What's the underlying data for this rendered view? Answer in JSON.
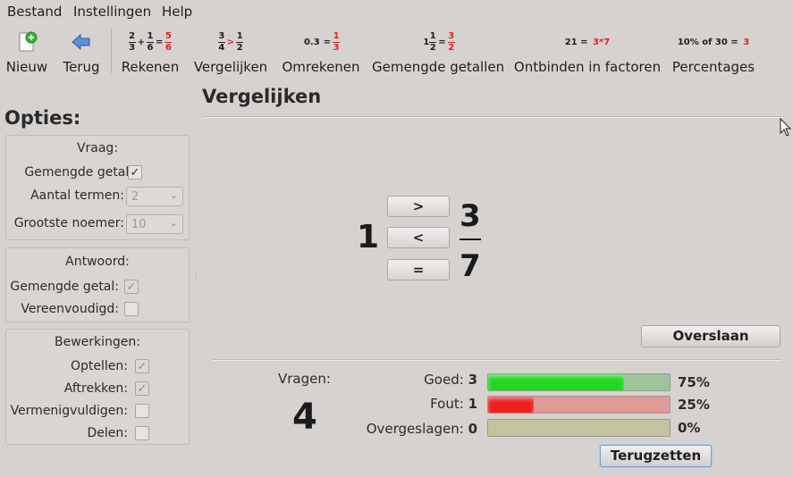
{
  "menu": {
    "items": [
      "Bestand",
      "Instellingen",
      "Help"
    ]
  },
  "toolbar": {
    "new_label": "Nieuw",
    "back_label": "Terug",
    "modes": [
      {
        "label": "Rekenen"
      },
      {
        "label": "Vergelijken"
      },
      {
        "label": "Omrekenen"
      },
      {
        "label": "Gemengde getallen"
      },
      {
        "label": "Ontbinden in factoren"
      },
      {
        "label": "Percentages"
      }
    ],
    "icons": {
      "decimal_text": "0.3",
      "factor_text": "21 = ",
      "factor_result": "3*7",
      "percent_text": "10% of 30 = ",
      "percent_result": "3"
    }
  },
  "page": {
    "title": "Vergelijken"
  },
  "options": {
    "heading": "Opties:",
    "question": {
      "title": "Vraag:",
      "mixed_label": "Gemengde getal:",
      "mixed_checked": true,
      "terms_label": "Aantal termen:",
      "terms_value": "2",
      "denominator_label": "Grootste noemer:",
      "denominator_value": "10"
    },
    "answer": {
      "title": "Antwoord:",
      "mixed_label": "Gemengde getal:",
      "mixed_checked": true,
      "reduced_label": "Vereenvoudigd:",
      "reduced_checked": false
    },
    "operations": {
      "title": "Bewerkingen:",
      "add_label": "Optellen:",
      "add_checked": true,
      "subtract_label": "Aftrekken:",
      "subtract_checked": true,
      "multiply_label": "Vermenigvuldigen:",
      "multiply_checked": false,
      "divide_label": "Delen:",
      "divide_checked": false
    }
  },
  "exercise": {
    "left_number": "1",
    "right_numerator": "3",
    "right_denominator": "7",
    "buttons": {
      "greater": ">",
      "less": "<",
      "equal": "="
    },
    "skip_label": "Overslaan"
  },
  "stats": {
    "questions_label": "Vragen:",
    "questions_count": "4",
    "correct_label": "Goed:",
    "correct_count": "3",
    "correct_pct": "75%",
    "correct_fraction": 0.75,
    "wrong_label": "Fout:",
    "wrong_count": "1",
    "wrong_pct": "25%",
    "wrong_fraction": 0.25,
    "skipped_label": "Overgeslagen:",
    "skipped_count": "0",
    "skipped_pct": "0%",
    "skipped_fraction": 0,
    "reset_label": "Terugzetten"
  },
  "colors": {
    "correct_fill": "#22d822",
    "correct_track": "#9fc49c",
    "wrong_fill": "#ee1f1f",
    "wrong_track": "#e09a98",
    "skipped_track": "#c5c39f"
  }
}
